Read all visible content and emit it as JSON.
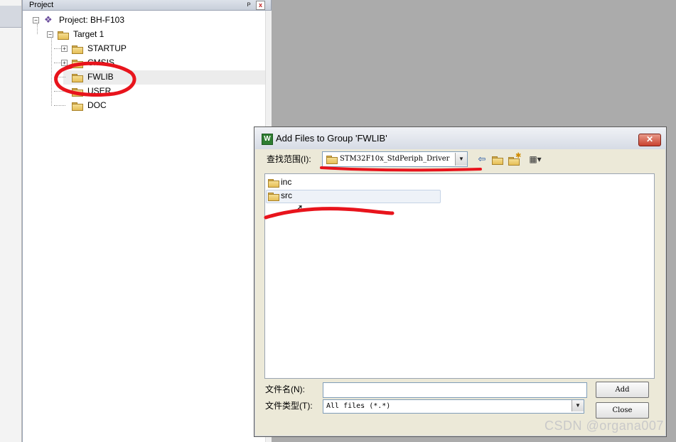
{
  "project_panel": {
    "title": "Project",
    "pin_glyph": "ᴘ",
    "close_glyph": "x",
    "tree": {
      "project": "Project: BH-F103",
      "target": "Target 1",
      "groups": [
        "STARTUP",
        "CMSIS",
        "FWLIB",
        "USER",
        "DOC"
      ],
      "selected": "FWLIB"
    }
  },
  "dialog": {
    "title": "Add Files to Group 'FWLIB'",
    "app_icon_letter": "W",
    "close_glyph": "✕",
    "look_in_label": "查找范围(I):",
    "look_in_value": "STM32F10x_StdPeriph_Driver",
    "toolbar_icons": [
      "back-icon",
      "up-folder-icon",
      "new-folder-icon",
      "view-menu-icon"
    ],
    "files": [
      "inc",
      "src"
    ],
    "hovered_file": "src",
    "file_name_label": "文件名(N):",
    "file_name_value": "",
    "file_type_label": "文件类型(T):",
    "file_type_value": "All files (*.*)",
    "add_button": "Add",
    "close_button": "Close"
  },
  "colors": {
    "annotation_red": "#e8141c",
    "folder_fill": "#e9c463"
  },
  "watermark": "CSDN @organa007"
}
